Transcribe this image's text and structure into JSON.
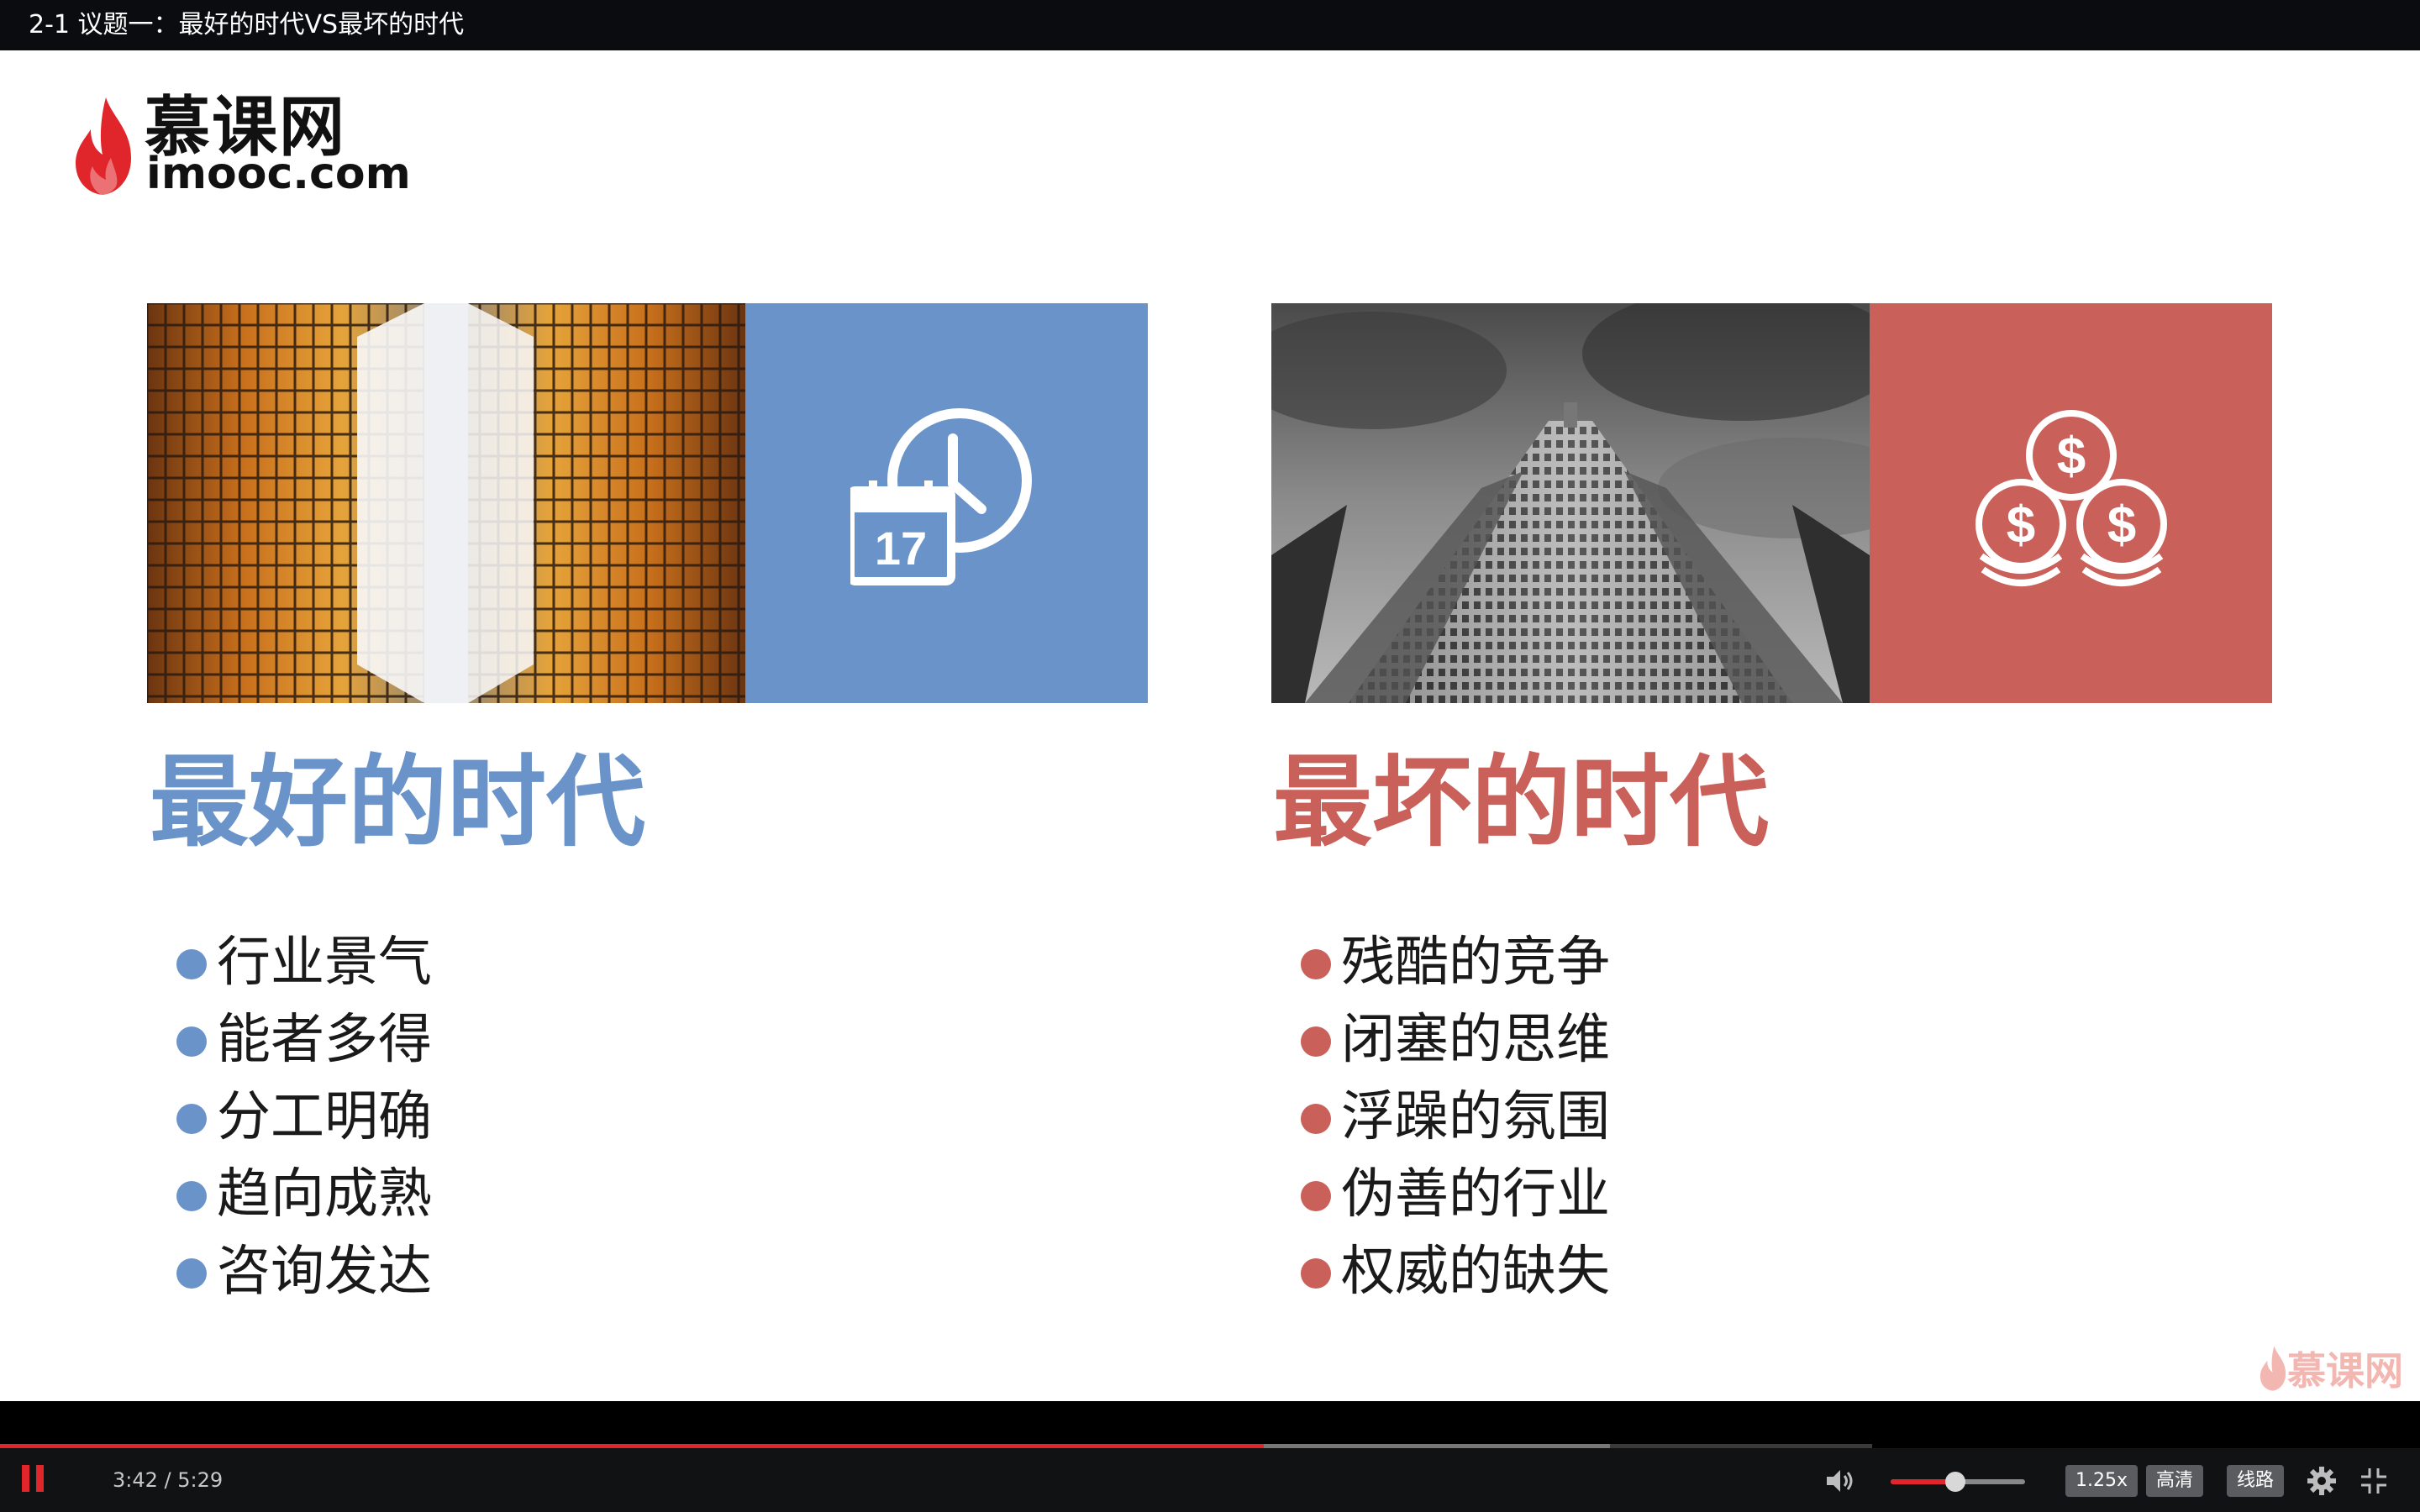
{
  "window": {
    "title": "2-1 议题一：最好的时代VS最坏的时代"
  },
  "slide": {
    "logo": {
      "cn": "慕课网",
      "en": "imooc.com"
    },
    "left": {
      "heading": "最好的时代",
      "accent": "#6a93c9",
      "icon": "calendar-clock-icon",
      "calendar_day": "17",
      "items": [
        "行业景气",
        "能者多得",
        "分工明确",
        "趋向成熟",
        "咨询发达"
      ]
    },
    "right": {
      "heading": "最坏的时代",
      "accent": "#c9605a",
      "icon": "coins-icon",
      "coin_symbol": "$",
      "items": [
        "残酷的竞争",
        "闭塞的思维",
        "浮躁的氛围",
        "伪善的行业",
        "权威的缺失"
      ]
    },
    "watermark": "慕课网"
  },
  "player": {
    "time_text": "3:42 / 5:29",
    "progress": 0.675,
    "buffered": 0.86,
    "volume": 0.48,
    "speed_label": "1.25x",
    "quality_label": "高清",
    "route_label": "线路",
    "accent": "#e0262b"
  }
}
